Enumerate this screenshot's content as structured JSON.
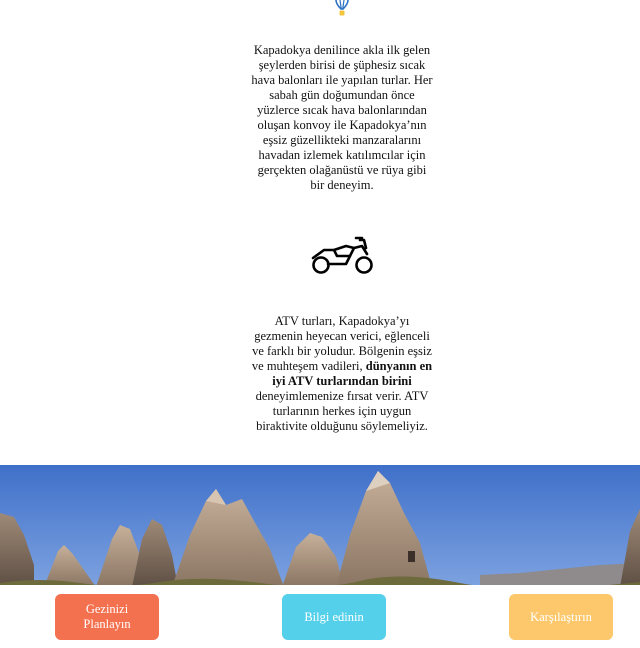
{
  "icons": {
    "balloon": "hot-air-balloon-icon",
    "motorcycle": "motorcycle-icon"
  },
  "sections": {
    "balloon_text": "Kapadokya denilince akla ilk gelen şeylerden birisi de şüphesiz sıcak hava balonları ile yapılan turlar. Her sabah gün doğumundan önce yüzlerce sıcak hava balonlarından oluşan konvoy ile Kapadokya’nın eşsiz güzellikteki manzaralarını havadan izlemek katılımcılar için gerçekten olağanüstü ve rüya gibi bir deneyim.",
    "atv_text_before": "ATV turları, Kapadokya’yı gezmenin heyecan verici, eğlenceli ve farklı bir yoludur. Bölgenin eşsiz ve muhteşem vadileri, ",
    "atv_text_bold": "dünyanın en iyi ATV turlarından birini",
    "atv_text_after": " deneyimlemenize fırsat verir. ATV turlarının herkes için uygun biraktivite olduğunu söylemeliyiz."
  },
  "buttons": {
    "plan": "Gezinizi Planlayın",
    "info": "Bilgi edinin",
    "compare": "Karşılaştırın"
  },
  "colors": {
    "plan": "#f4714f",
    "info": "#55d0ea",
    "compare": "#fdc86b"
  }
}
